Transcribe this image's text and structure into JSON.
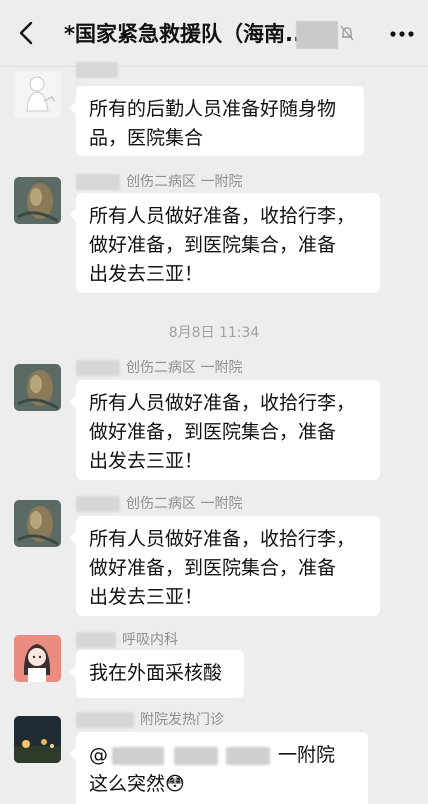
{
  "header": {
    "title": "*国家紧急救援队（海南..."
  },
  "timestamp": "8月8日 11:34",
  "messages": [
    {
      "sender": "",
      "lines": [
        "所有的后勤人员准备好随身物",
        "品，医院集合"
      ]
    },
    {
      "sender": "创伤二病区 一附院",
      "lines": [
        "所有人员做好准备，收拾行李，",
        "做好准备，到医院集合，准备",
        "出发去三亚！"
      ]
    },
    {
      "sender": "创伤二病区 一附院",
      "lines": [
        "所有人员做好准备，收拾行李，",
        "做好准备，到医院集合，准备",
        "出发去三亚！"
      ]
    },
    {
      "sender": "创伤二病区 一附院",
      "lines": [
        "所有人员做好准备，收拾行李，",
        "做好准备，到医院集合，准备",
        "出发去三亚！"
      ]
    },
    {
      "sender": "呼吸内科",
      "lines": [
        "我在外面采核酸"
      ]
    },
    {
      "sender": "附院发热门诊",
      "line1_start": "@",
      "line1_end": "一附院",
      "line2": "这么突然",
      "emoji": "😳"
    }
  ],
  "icons": {
    "back": "back-chevron-icon",
    "mute": "bell-mute-icon",
    "more": "more-dots-icon"
  },
  "colors": {
    "background": "#ededed",
    "bubble": "#ffffff",
    "name_text": "#8f8f8f"
  }
}
